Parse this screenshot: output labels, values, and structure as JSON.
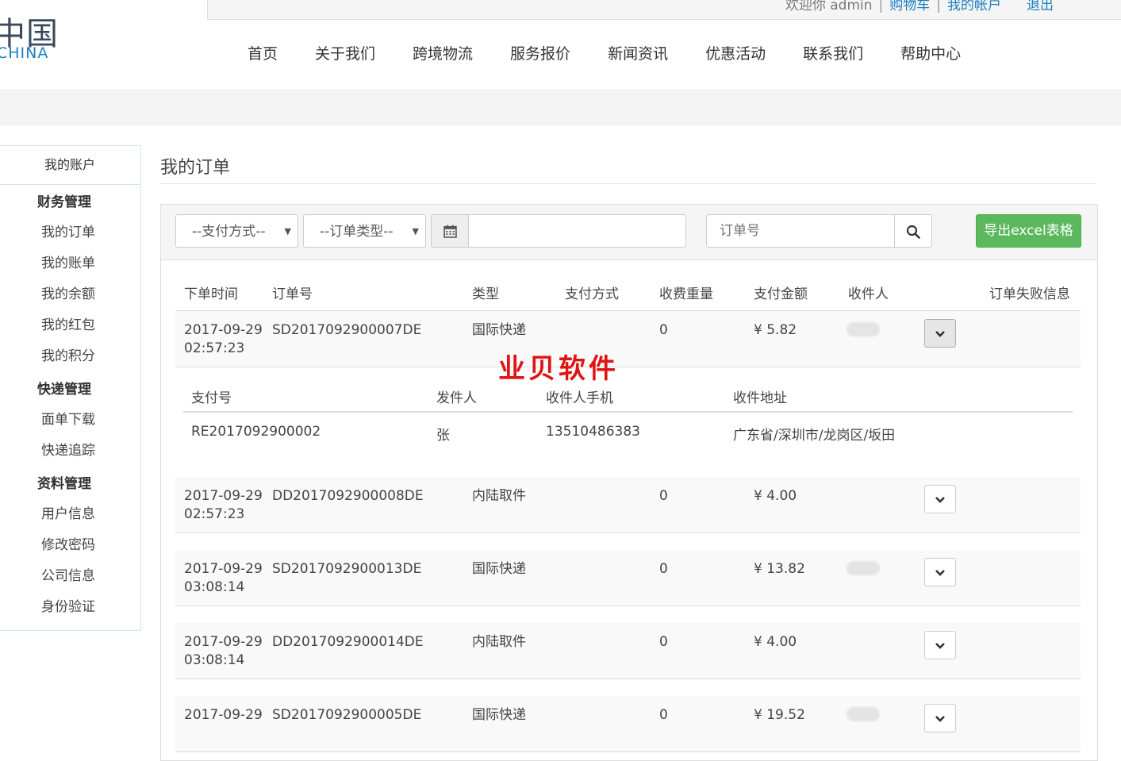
{
  "logo": {
    "cn": "中国",
    "en": "CHINA"
  },
  "topbar": {
    "welcome": "欢迎你 admin",
    "cart": "购物车",
    "account": "我的帐户",
    "logout": "退出"
  },
  "nav": [
    "首页",
    "关于我们",
    "跨境物流",
    "服务报价",
    "新闻资讯",
    "优惠活动",
    "联系我们",
    "帮助中心"
  ],
  "sidebar": {
    "header": "我的账户",
    "groups": [
      {
        "title": "财务管理",
        "items": [
          "我的订单",
          "我的账单",
          "我的余额",
          "我的红包",
          "我的积分"
        ]
      },
      {
        "title": "快递管理",
        "items": [
          "面单下载",
          "快递追踪"
        ]
      },
      {
        "title": "资料管理",
        "items": [
          "用户信息",
          "修改密码",
          "公司信息",
          "身份验证"
        ]
      }
    ]
  },
  "page_title": "我的订单",
  "filters": {
    "payment_select": "--支付方式--",
    "type_select": "--订单类型--",
    "date_value": "",
    "order_placeholder": "订单号",
    "export_label": "导出excel表格"
  },
  "table": {
    "headers": [
      "下单时间",
      "订单号",
      "类型",
      "支付方式",
      "收费重量",
      "支付金额",
      "收件人",
      "订单失败信息"
    ],
    "rows": [
      {
        "date": "2017-09-29",
        "time": "02:57:23",
        "order_no": "SD2017092900007DE",
        "type": "国际快递",
        "payment": "",
        "weight": "0",
        "amount": "¥ 5.82",
        "recipient_blurred": true
      },
      {
        "date": "2017-09-29",
        "time": "02:57:23",
        "order_no": "DD2017092900008DE",
        "type": "内陆取件",
        "payment": "",
        "weight": "0",
        "amount": "¥ 4.00",
        "recipient_blurred": false
      },
      {
        "date": "2017-09-29",
        "time": "03:08:14",
        "order_no": "SD2017092900013DE",
        "type": "国际快递",
        "payment": "",
        "weight": "0",
        "amount": "¥ 13.82",
        "recipient_blurred": true
      },
      {
        "date": "2017-09-29",
        "time": "03:08:14",
        "order_no": "DD2017092900014DE",
        "type": "内陆取件",
        "payment": "",
        "weight": "0",
        "amount": "¥ 4.00",
        "recipient_blurred": false
      },
      {
        "date": "2017-09-29",
        "time": "",
        "order_no": "SD2017092900005DE",
        "type": "国际快递",
        "payment": "",
        "weight": "0",
        "amount": "¥ 19.52",
        "recipient_blurred": true
      }
    ]
  },
  "detail": {
    "headers": [
      "支付号",
      "发件人",
      "收件人手机",
      "收件地址"
    ],
    "values": [
      "RE2017092900002",
      "张",
      "13510486383",
      "广东省/深圳市/龙岗区/坂田"
    ]
  },
  "watermark": "业贝软件",
  "colors": {
    "accent": "#1a7fbf",
    "export_green": "#5cb85c",
    "watermark_red": "#e11414"
  }
}
